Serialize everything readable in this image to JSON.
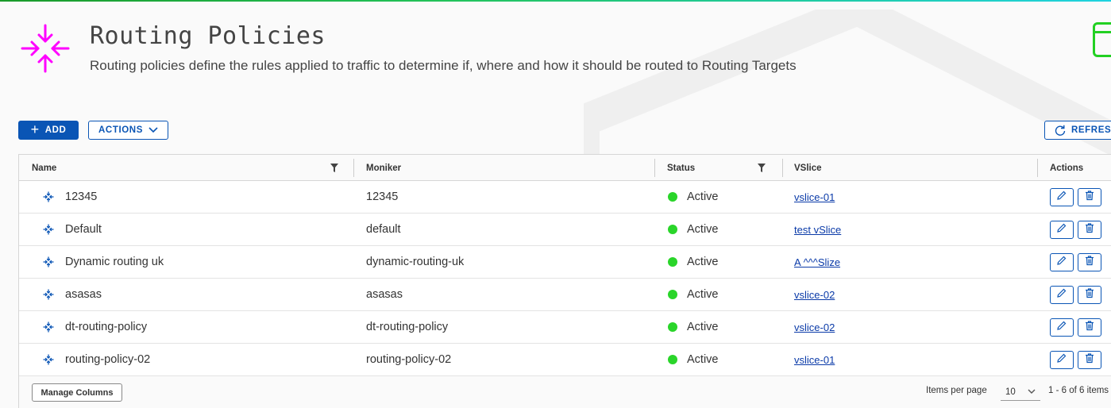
{
  "page": {
    "title": "Routing Policies",
    "subtitle": "Routing policies define the rules applied to traffic to determine if, where and how it should be routed to Routing Targets",
    "logo_icon": "arrows-converge-icon",
    "accent_color": "#ff00ff"
  },
  "toolbar": {
    "add_label": "ADD",
    "actions_label": "ACTIONS",
    "refresh_label": "REFRESH"
  },
  "table": {
    "columns": {
      "name": "Name",
      "moniker": "Moniker",
      "status": "Status",
      "vslice": "VSlice",
      "actions": "Actions"
    },
    "rows": [
      {
        "name": "12345",
        "moniker": "12345",
        "status": "Active",
        "vslice": "vslice-01"
      },
      {
        "name": "Default",
        "moniker": "default",
        "status": "Active",
        "vslice": "test vSlice"
      },
      {
        "name": "Dynamic routing uk",
        "moniker": "dynamic-routing-uk",
        "status": "Active",
        "vslice": "A ^^^Slize"
      },
      {
        "name": "asasas",
        "moniker": "asasas",
        "status": "Active",
        "vslice": "vslice-02"
      },
      {
        "name": "dt-routing-policy",
        "moniker": "dt-routing-policy",
        "status": "Active",
        "vslice": "vslice-02"
      },
      {
        "name": "routing-policy-02",
        "moniker": "routing-policy-02",
        "status": "Active",
        "vslice": "vslice-01"
      }
    ],
    "status_color": "#2ad52a",
    "primary_color": "#0a55b5"
  },
  "footer": {
    "manage_columns_label": "Manage Columns",
    "items_per_page_label": "Items per page",
    "items_per_page_value": "10",
    "range_text": "1 - 6 of 6 items"
  }
}
